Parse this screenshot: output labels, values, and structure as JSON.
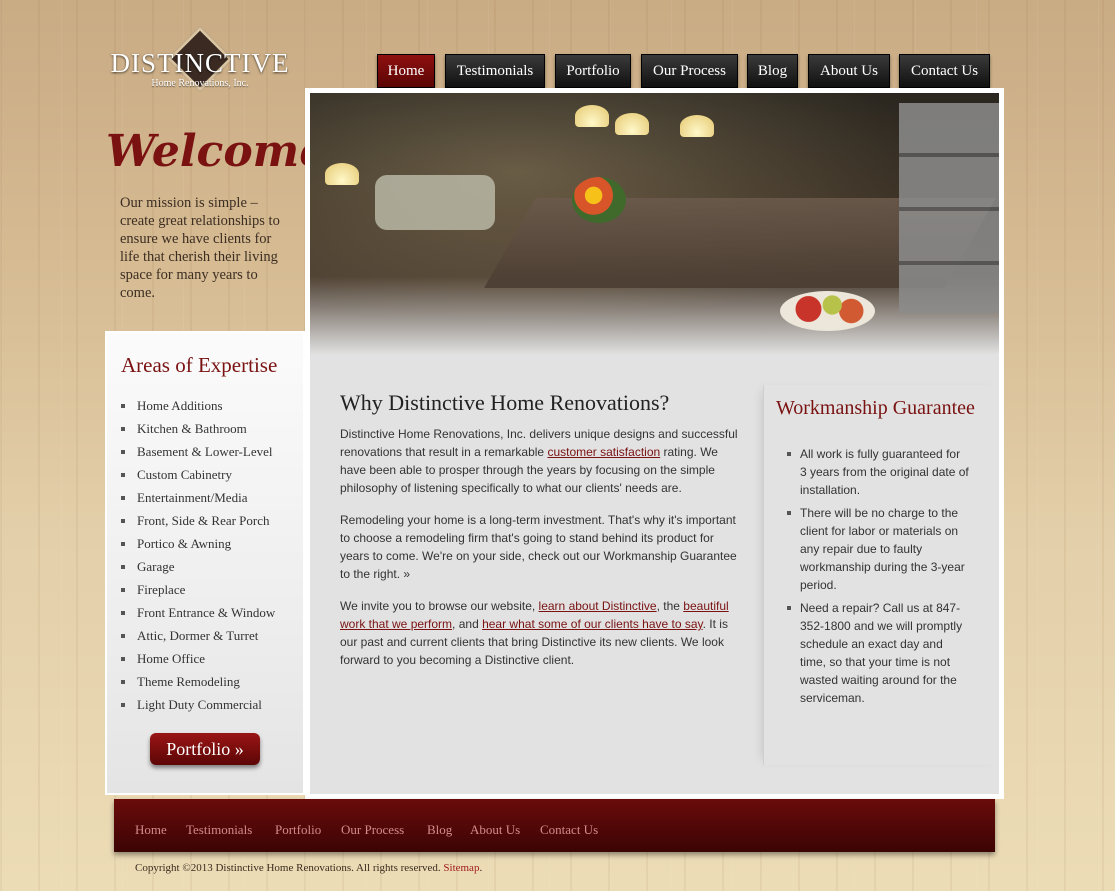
{
  "brand": {
    "name": "DISTINCTIVE",
    "subtitle": "Home Renovations, Inc."
  },
  "nav": {
    "items": [
      "Home",
      "Testimonials",
      "Portfolio",
      "Our Process",
      "Blog",
      "About Us",
      "Contact Us"
    ],
    "active": "Home"
  },
  "welcome": {
    "title": "Welcome!",
    "mission": "Our mission is simple – create great relationships to ensure we have clients for life that cherish their living space for many years to come."
  },
  "sidebar": {
    "heading": "Areas of Expertise",
    "items": [
      "Home Additions",
      "Kitchen & Bathroom",
      "Basement & Lower-Level",
      "Custom Cabinetry",
      "Entertainment/Media",
      "Front, Side & Rear Porch",
      "Portico & Awning",
      "Garage",
      "Fireplace",
      "Front Entrance & Window",
      "Attic, Dormer & Turret",
      "Home Office",
      "Theme Remodeling",
      "Light Duty Commercial"
    ],
    "button_label": "Portfolio »"
  },
  "main": {
    "heading": "Why Distinctive Home Renovations?",
    "p1_a": "Distinctive Home Renovations, Inc. delivers unique designs and successful renovations that result in a remarkable ",
    "p1_link": "customer satisfaction",
    "p1_b": " rating. We have been able to prosper through the years by focusing on the simple philosophy of listening specifically to what our clients' needs are.",
    "p2": "Remodeling your home is a long-term investment. That's why it's important to choose a remodeling firm that's going to stand behind its product for years to come. We're on your side, check out our Workmanship Guarantee to the right. »",
    "p3_a": "We invite you to browse our website, ",
    "p3_link1": "learn about Distinctive",
    "p3_b": ", the ",
    "p3_link2": "beautiful work that we perform",
    "p3_c": ", and ",
    "p3_link3": "hear what some of our clients have to say",
    "p3_d": ". It is our past and current clients that bring Distinctive its new clients. We look forward to you becoming a Distinctive client."
  },
  "guarantee": {
    "heading": "Workmanship Guarantee",
    "items": [
      "All work is fully guaranteed for 3 years from the original date of installation.",
      "There will be no charge to the client for labor or materials on any repair due to faulty workmanship during the 3-year period.",
      "Need a repair? Call us at 847-352-1800 and we will promptly schedule an exact day and time, so that your time is not wasted waiting around for the serviceman."
    ]
  },
  "footer": {
    "links": [
      "Home",
      "Testimonials",
      "Portfolio",
      "Our Process",
      "Blog",
      "About Us",
      "Contact Us"
    ],
    "copyright": "Copyright ©2013 Distinctive Home Renovations. All rights reserved.",
    "sitemap": "Sitemap",
    "period": "."
  },
  "colors": {
    "accent": "#7a1212",
    "footer": "#5a0808",
    "nav": "#1c1c1c"
  }
}
